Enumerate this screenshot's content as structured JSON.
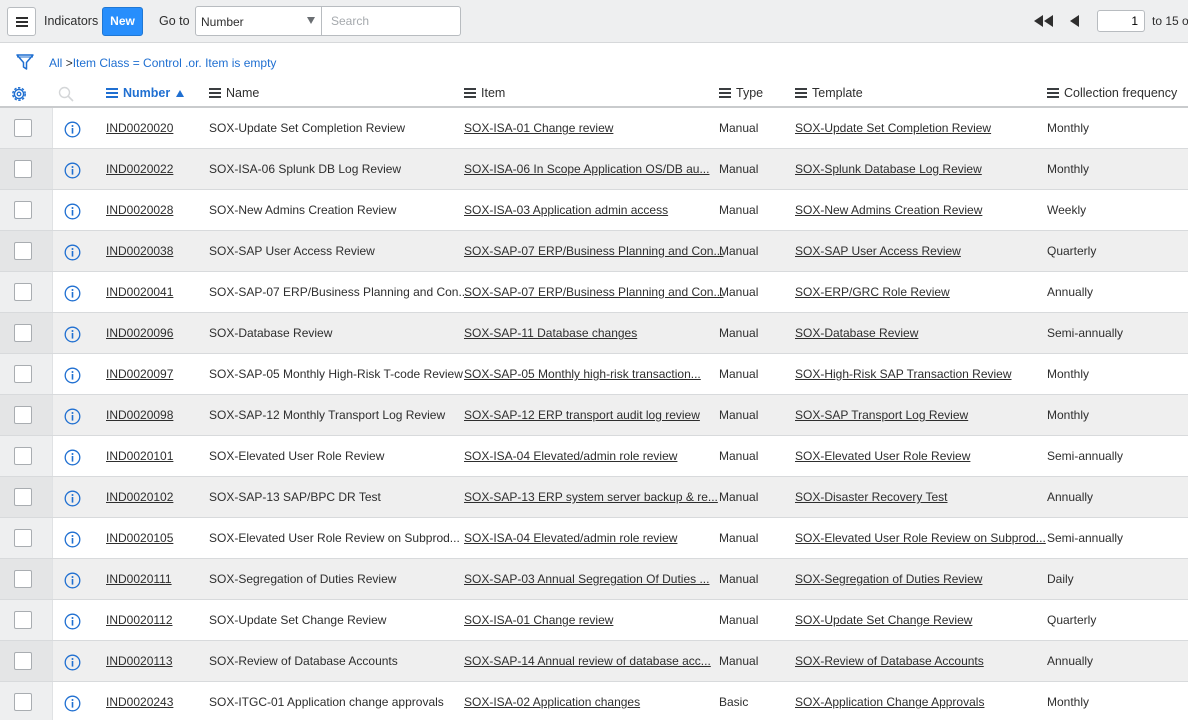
{
  "header": {
    "title": "Indicators",
    "new_label": "New",
    "goto_label": "Go to",
    "goto_field": "Number",
    "search_placeholder": "Search",
    "page_value": "1",
    "page_total": "to 15 o"
  },
  "breadcrumb": {
    "all": "All",
    "separator": ">",
    "filter": "Item Class = Control .or. Item is empty"
  },
  "columns": {
    "number": "Number",
    "name": "Name",
    "item": "Item",
    "type": "Type",
    "template": "Template",
    "frequency": "Collection frequency"
  },
  "colors": {
    "accent": "#278efc",
    "link": "#1f6fd1",
    "header_bg": "#eeeff0"
  },
  "rows": [
    {
      "number": "IND0020020",
      "name": "SOX-Update Set Completion Review",
      "item": "SOX-ISA-01 Change review",
      "type": "Manual",
      "template": "SOX-Update Set Completion Review",
      "frequency": "Monthly"
    },
    {
      "number": "IND0020022",
      "name": "SOX-ISA-06 Splunk DB Log Review",
      "item": "SOX-ISA-06 In Scope Application OS/DB au...",
      "type": "Manual",
      "template": "SOX-Splunk Database Log Review",
      "frequency": "Monthly"
    },
    {
      "number": "IND0020028",
      "name": "SOX-New Admins Creation Review",
      "item": "SOX-ISA-03 Application admin access",
      "type": "Manual",
      "template": "SOX-New Admins Creation Review",
      "frequency": "Weekly"
    },
    {
      "number": "IND0020038",
      "name": "SOX-SAP User Access Review",
      "item": "SOX-SAP-07 ERP/Business Planning and Con...",
      "type": "Manual",
      "template": "SOX-SAP User Access Review",
      "frequency": "Quarterly"
    },
    {
      "number": "IND0020041",
      "name": "SOX-SAP-07 ERP/Business Planning and Con...",
      "item": "SOX-SAP-07 ERP/Business Planning and Con...",
      "type": "Manual",
      "template": "SOX-ERP/GRC Role Review",
      "frequency": "Annually"
    },
    {
      "number": "IND0020096",
      "name": "SOX-Database Review",
      "item": "SOX-SAP-11 Database changes",
      "type": "Manual",
      "template": "SOX-Database Review",
      "frequency": "Semi-annually"
    },
    {
      "number": "IND0020097",
      "name": "SOX-SAP-05 Monthly High-Risk T-code Review",
      "item": "SOX-SAP-05 Monthly high-risk transaction...",
      "type": "Manual",
      "template": "SOX-High-Risk SAP Transaction Review",
      "frequency": "Monthly"
    },
    {
      "number": "IND0020098",
      "name": "SOX-SAP-12 Monthly Transport Log Review",
      "item": "SOX-SAP-12 ERP transport audit log review",
      "type": "Manual",
      "template": "SOX-SAP Transport Log Review",
      "frequency": "Monthly"
    },
    {
      "number": "IND0020101",
      "name": "SOX-Elevated User Role Review",
      "item": "SOX-ISA-04 Elevated/admin role review",
      "type": "Manual",
      "template": "SOX-Elevated User Role Review",
      "frequency": "Semi-annually"
    },
    {
      "number": "IND0020102",
      "name": "SOX-SAP-13 SAP/BPC DR Test",
      "item": "SOX-SAP-13 ERP system server backup & re...",
      "type": "Manual",
      "template": "SOX-Disaster Recovery Test",
      "frequency": "Annually"
    },
    {
      "number": "IND0020105",
      "name": "SOX-Elevated User Role Review on Subprod...",
      "item": "SOX-ISA-04 Elevated/admin role review",
      "type": "Manual",
      "template": "SOX-Elevated User Role Review on Subprod...",
      "frequency": "Semi-annually"
    },
    {
      "number": "IND0020111",
      "name": "SOX-Segregation of Duties Review",
      "item": "SOX-SAP-03 Annual Segregation Of Duties ...",
      "type": "Manual",
      "template": "SOX-Segregation of Duties Review",
      "frequency": "Daily"
    },
    {
      "number": "IND0020112",
      "name": "SOX-Update Set Change Review",
      "item": "SOX-ISA-01 Change review",
      "type": "Manual",
      "template": "SOX-Update Set Change Review",
      "frequency": "Quarterly"
    },
    {
      "number": "IND0020113",
      "name": "SOX-Review of Database Accounts",
      "item": "SOX-SAP-14 Annual review of database acc...",
      "type": "Manual",
      "template": "SOX-Review of Database Accounts",
      "frequency": "Annually"
    },
    {
      "number": "IND0020243",
      "name": "SOX-ITGC-01 Application change approvals",
      "item": "SOX-ISA-02 Application changes",
      "type": "Basic",
      "template": "SOX-Application Change Approvals",
      "frequency": "Monthly"
    }
  ]
}
